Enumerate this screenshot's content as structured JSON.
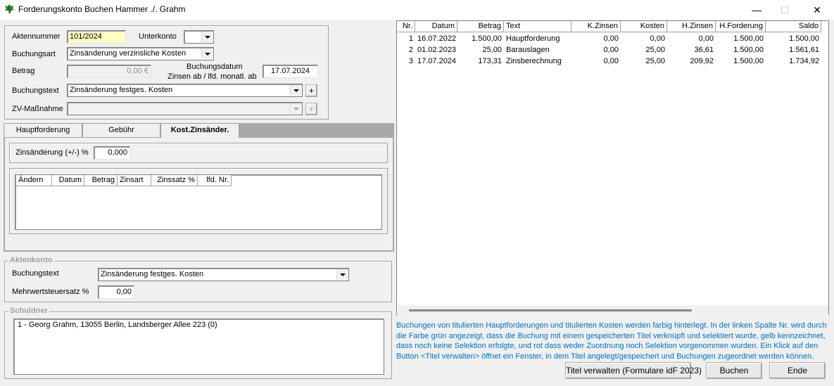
{
  "window": {
    "title": "Forderungskonto Buchen Hammer ./. Grahm",
    "minimize_glyph": "—",
    "maximize_glyph": "☐",
    "close_glyph": "✕"
  },
  "form": {
    "aktennummer_label": "Aktennummer",
    "aktennummer_value": "101/2024",
    "unterkonto_label": "Unterkonto",
    "unterkonto_value": "",
    "buchungsart_label": "Buchungsart",
    "buchungsart_value": "Zinsänderung verzinsliche Kosten",
    "betrag_label": "Betrag",
    "betrag_value": "0,00 €",
    "buchungsdatum_label_1": "Buchungsdatum",
    "buchungsdatum_label_2": "Zinsen ab / lfd. monatl. ab",
    "buchungsdatum_value": "17.07.2024",
    "buchungstext_label": "Buchungstext",
    "buchungstext_value": "Zinsänderung festges. Kosten",
    "plus_glyph": "+",
    "zv_label": "ZV-Maßnahme",
    "zv_value": ""
  },
  "tabs": [
    {
      "label": "Hauptforderung"
    },
    {
      "label": "Gebühr"
    },
    {
      "label": "Kost.Zinsänder."
    }
  ],
  "kost_tab": {
    "zinsaenderung_label": "Zinsänderung (+/-) %",
    "zinsaenderung_value": "0,000",
    "columns": [
      "Ändern",
      "Datum",
      "Betrag",
      "Zinsart",
      "Zinssatz %",
      "lfd. Nr."
    ]
  },
  "aktenkonto": {
    "group_title": "Aktenkonto",
    "buchungstext_label": "Buchungstext",
    "buchungstext_value": "Zinsänderung festges. Kosten",
    "mwst_label": "Mehrwertsteuersatz %",
    "mwst_value": "0,00"
  },
  "schuldner": {
    "group_title": "Schuldner",
    "entry": "1 - Georg Grahm, 13055 Berlin, Landsberger Allee 223 (0)"
  },
  "ledger": {
    "columns": [
      "Nr.",
      "Datum",
      "Betrag",
      "Text",
      "K.Zinsen",
      "Kosten",
      "H.Zinsen",
      "H.Forderung",
      "Saldo"
    ],
    "rows": [
      [
        "1",
        "16.07.2022",
        "1.500,00",
        "Hauptforderung",
        "0,00",
        "0,00",
        "0,00",
        "1.500,00",
        "1.500,00"
      ],
      [
        "2",
        "01.02.2023",
        "25,00",
        "Barauslagen",
        "0,00",
        "25,00",
        "36,61",
        "1.500,00",
        "1.561,61"
      ],
      [
        "3",
        "17.07.2024",
        "173,31",
        "Zinsberechnung",
        "0,00",
        "25,00",
        "209,92",
        "1.500,00",
        "1.734,92"
      ]
    ]
  },
  "info": "Buchungen von titulierten Hauptforderungen und titulierten Kosten werden farbig hinterlegt. In der linken Spalte Nr. wird durch die Farbe grün angezeigt, dass die Buchung mit einem gespeicherten Titel verknüpft und selektiert wurde, gelb kennzeichnet, dass noch keine Selektion erfolgte, und rot dass weder Zuordnung noch Selektion vorgenommen wurden. Ein Klick auf den Button <Titel verwalten> öffnet ein Fenster, in dem Titel angelegt/gespeichert und Buchungen zugeordnet werden können.",
  "buttons": {
    "titel_verwalten": "Titel verwalten (Formulare idF 2023)",
    "buchen": "Buchen",
    "ende": "Ende"
  },
  "colors": {
    "accent_yellow": "#ffffc6",
    "info_blue": "#0070c0",
    "icon_green": "#2e7d32"
  }
}
